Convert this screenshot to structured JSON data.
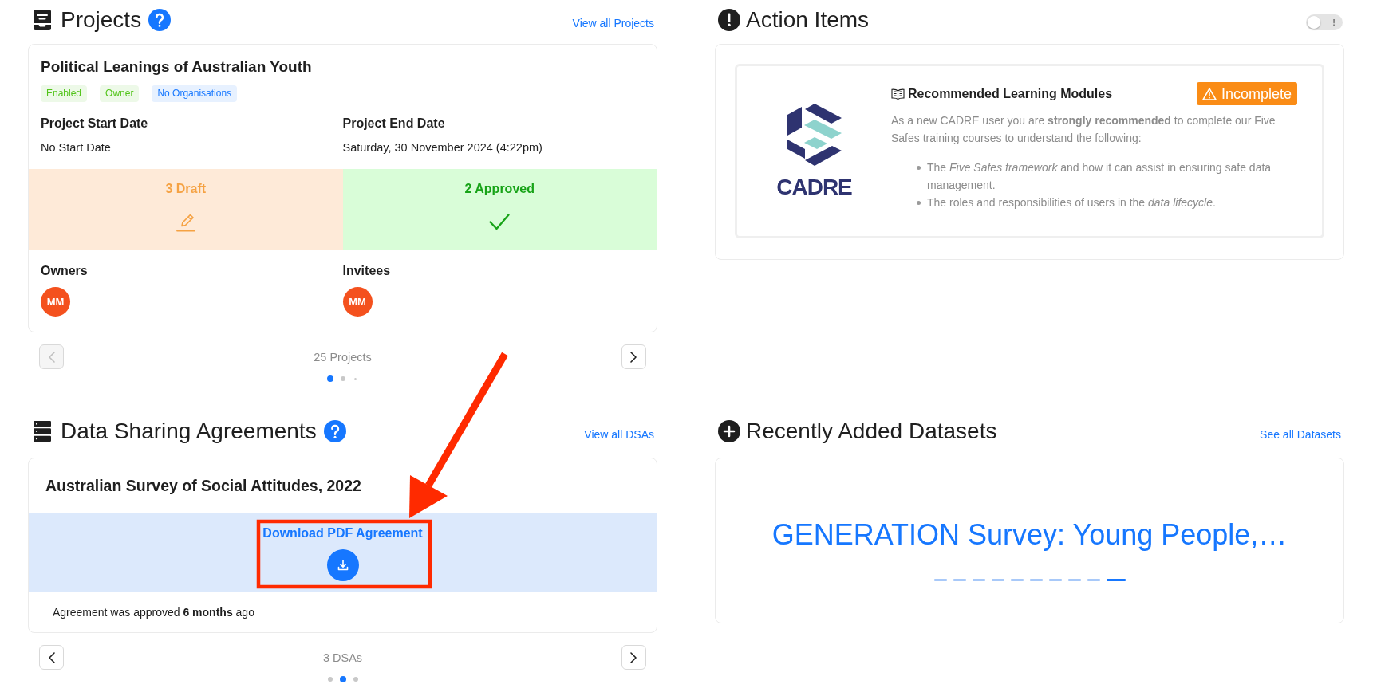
{
  "projects": {
    "title": "Projects",
    "view_all": "View all Projects",
    "card": {
      "title": "Political Leanings of Australian Youth",
      "tags": [
        {
          "label": "Enabled",
          "color": "#52c41a"
        },
        {
          "label": "Owner",
          "color": "#52c41a"
        },
        {
          "label": "No Organisations",
          "color": "#1677ff"
        }
      ],
      "dates": [
        {
          "label": "Project Start Date",
          "value": "No Start Date"
        },
        {
          "label": "Project End Date",
          "value": "Saturday, 30 November 2024 (4:22pm)"
        }
      ],
      "statuses": [
        {
          "kind": "draft",
          "label": "3 Draft"
        },
        {
          "kind": "approved",
          "label": "2 Approved"
        }
      ],
      "people": [
        {
          "label": "Owners",
          "avatars": [
            {
              "initials": "MM"
            }
          ]
        },
        {
          "label": "Invitees",
          "avatars": [
            {
              "initials": "MM"
            }
          ]
        }
      ]
    },
    "pager": {
      "prev": {
        "disabled": true
      },
      "count": "25 Projects",
      "next": {
        "disabled": false
      },
      "dots": [
        {
          "selected": true
        },
        {
          "selected": false
        },
        {
          "selected": false
        }
      ]
    }
  },
  "action_items": {
    "title": "Action Items",
    "toggle": {
      "on": false,
      "label": "!"
    },
    "module": {
      "logo_text": "CADRE",
      "title": "Recommended Learning Modules",
      "status": "Incomplete",
      "intro": "As a new CADRE user you are **strongly recommended** to complete our Five Safes training courses to understand the following:",
      "points": [
        "The *Five Safes framework* and how it can assist in ensuring safe data management.",
        "The roles and responsibilities of users in the *data lifecycle*."
      ]
    }
  },
  "dsas": {
    "title": "Data Sharing Agreements",
    "view_all": "View all DSAs",
    "card": {
      "title": "Australian Survey of Social Attitudes, 2022",
      "download_link": "Download PDF Agreement",
      "note": "Agreement was approved **6 months** ago"
    },
    "pager": {
      "prev": {
        "disabled": false
      },
      "count": "3 DSAs",
      "next": {
        "disabled": false
      },
      "dots": [
        {
          "selected": false
        },
        {
          "selected": true
        },
        {
          "selected": false
        }
      ]
    }
  },
  "datasets": {
    "title": "Recently Added Datasets",
    "view_all": "See all Datasets",
    "featured_title": "GENERATION Survey: Young People,…",
    "slides": [
      {
        "selected": false
      },
      {
        "selected": false
      },
      {
        "selected": false
      },
      {
        "selected": false
      },
      {
        "selected": false
      },
      {
        "selected": false
      },
      {
        "selected": false
      },
      {
        "selected": false
      },
      {
        "selected": false
      },
      {
        "selected": true
      }
    ]
  },
  "annotation": {
    "kind": "arrow_to_box"
  }
}
